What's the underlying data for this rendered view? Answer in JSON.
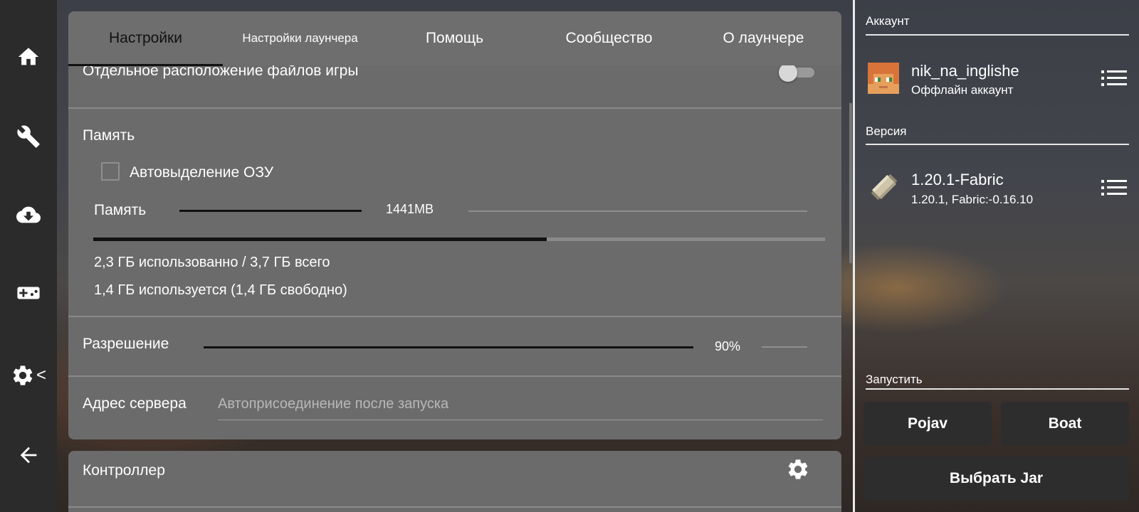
{
  "tabs": [
    {
      "label": "Настройки",
      "active": true
    },
    {
      "label": "Настройки лаунчера",
      "active": false
    },
    {
      "label": "Помощь",
      "active": false
    },
    {
      "label": "Сообщество",
      "active": false
    },
    {
      "label": "О лаунчере",
      "active": false
    }
  ],
  "settings": {
    "separate_location_label": "Отдельное расположение файлов игры",
    "separate_location_enabled": false,
    "memory_section_title": "Память",
    "auto_ram_label": "Автовыделение ОЗУ",
    "auto_ram_checked": false,
    "memory_label": "Память",
    "memory_value": "1441MB",
    "memory_usage_fraction": 0.62,
    "memory_used_text": "2,3 ГБ использованно / 3,7 ГБ всего",
    "memory_free_text": "1,4 ГБ используется (1,4 ГБ свободно)",
    "resolution_label": "Разрешение",
    "resolution_value": "90%",
    "server_label": "Адрес сервера",
    "server_placeholder": "Автоприсоединение после запуска",
    "controller_label": "Контроллер"
  },
  "nav": {
    "icons": [
      "home-icon",
      "wrench-icon",
      "cloud-download-icon",
      "gamepad-icon",
      "gear-icon",
      "back-arrow-icon"
    ],
    "active_caret": "<"
  },
  "account": {
    "section_title": "Аккаунт",
    "name": "nik_na_inglishe",
    "type": "Оффлайн аккаунт"
  },
  "version": {
    "section_title": "Версия",
    "name": "1.20.1-Fabric",
    "details": "1.20.1, Fabric:-0.16.10"
  },
  "launch": {
    "section_title": "Запустить",
    "pojav_label": "Pojav",
    "boat_label": "Boat",
    "jar_label": "Выбрать Jar"
  }
}
